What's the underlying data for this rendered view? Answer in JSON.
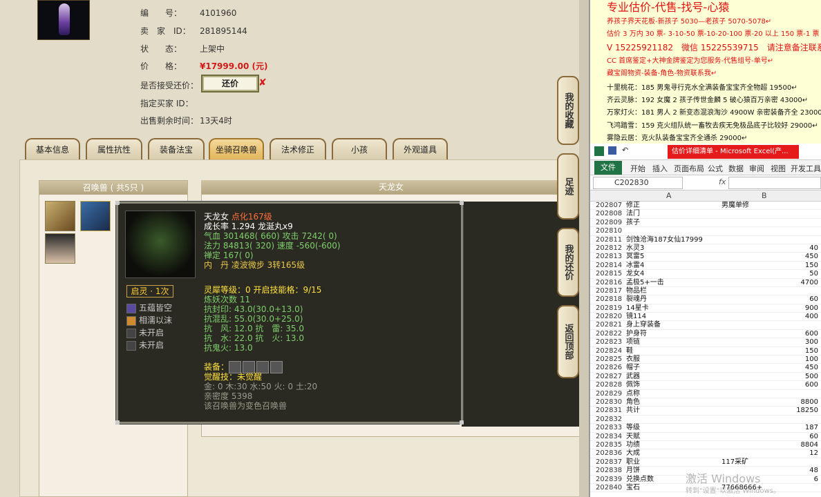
{
  "listing": {
    "serial_label": "编　　号：",
    "serial": "4101960",
    "seller_label": "卖　家　ID：",
    "seller_id": "281895144",
    "status_label": "状　　态：",
    "status": "上架中",
    "price_label": "价　　格：",
    "price": "¥17999.00 (元)",
    "bargain_label": "是否接受还价：",
    "bargain_button": "还价",
    "bargain_x": "✘",
    "buyer_label": "指定买家 ID：",
    "buyer": "",
    "time_label": "出售剩余时间：",
    "time_left": "13天4时"
  },
  "tabs": [
    "基本信息",
    "属性抗性",
    "装备法宝",
    "坐骑召唤兽",
    "法术修正",
    "小孩",
    "外观道具"
  ],
  "active_tab": "坐骑召唤兽",
  "pets": {
    "header": "召唤兽 ( 共5只 )",
    "detail_header": "天龙女"
  },
  "tooltip": {
    "name": "天龙女",
    "upgrade": "点化167级",
    "growth": "成长率 1.294 龙涎丸x9",
    "hp": "气血 301468( 660) 攻击 7242( 0)",
    "mp": "法力 84813( 320) 速度 -560(-600)",
    "zen": "禅定 167( 0)",
    "neidan": "内　丹 凌波微步 3转165级",
    "awaken": "启灵 · 1次",
    "skills": [
      "五蕴皆空",
      "相濡以沫",
      "未开启",
      "未开启"
    ],
    "spirit": "灵犀等级：0 开启技能格：9/15",
    "refine": "炼妖次数 11",
    "r1": "抗封印: 43.0(30.0+13.0)",
    "r2": "抗混乱: 55.0(30.0+25.0)",
    "r3": "抗　风: 12.0 抗　雷: 35.0",
    "r4": "抗　水: 22.0 抗　火: 13.0",
    "r5": "抗鬼火: 13.0",
    "equip_label": "装备：",
    "awake_skill": "觉醒技：未觉醒",
    "elements": "金: 0 木:30 水:50 火: 0 土:20",
    "intimacy": "亲密度 5398",
    "note": "该召唤兽为变色召唤兽"
  },
  "side_buttons": [
    "我的收藏",
    "足迹",
    "我的还价",
    "返回顶部"
  ],
  "ad": {
    "title": "专业估价-代售-找号-心猿",
    "l1": "养孩子界天花板-新孩子 5030—老孩子 5070-5078↵",
    "l2": "估价 3 万内 30 票- 3-10-50 票-10-20-100 票-20 以上 150 票-1 票",
    "l3": "V 15225921182　微信 15225539715　请注意备注联系↵",
    "l4": "CC 首席鉴定+大神金牌鉴定为您服务-代售组号-单号↵",
    "l5": "藏宝阁物资-装备-角色-物资联系我↵",
    "l6": "十里桃花：185 男鬼寻行克水全满装备宝宝齐全物超 19500↵",
    "l7": "齐云灵脉：192 女魔 2 孩子传世金麟 5 破心猿百万亲密 43000↵",
    "l8": "万家灯火：181 男人 2 新变态混浪淘沙 4900W 亲密装备齐全 23000",
    "l9": "飞鸿踏雪：159 克火组队统一畜牧去疾无免极品底子比较好 29000↵",
    "l10": "雾隐云居：克火队装备宝宝齐全通杀 29000↵"
  },
  "excel": {
    "title": "估价详细清单 - Microsoft Excel(产...",
    "file": "文件",
    "ribbon": [
      "开始",
      "插入",
      "页面布局",
      "公式",
      "数据",
      "审阅",
      "视图",
      "开发工具"
    ],
    "namebox": "C202830",
    "fx": "fx",
    "col_a": "A",
    "col_b": "B",
    "rows": [
      {
        "n": "202807",
        "a": "修正",
        "b": "男魔单修",
        "bl": true
      },
      {
        "n": "202808",
        "a": "法门",
        "b": ""
      },
      {
        "n": "202809",
        "a": "孩子",
        "b": ""
      },
      {
        "n": "202810",
        "a": "",
        "b": ""
      },
      {
        "n": "202811",
        "a": "剑蚀沧海187女仙17999",
        "b": ""
      },
      {
        "n": "202812",
        "a": "水灵3",
        "b": "40"
      },
      {
        "n": "202813",
        "a": "冥雷5",
        "b": "450"
      },
      {
        "n": "202814",
        "a": "冰雷4",
        "b": "150"
      },
      {
        "n": "202815",
        "a": "龙女4",
        "b": "50"
      },
      {
        "n": "202816",
        "a": "孟极5+一击",
        "b": "4700"
      },
      {
        "n": "202817",
        "a": "物品栏",
        "b": ""
      },
      {
        "n": "202818",
        "a": "裂魂丹",
        "b": "60"
      },
      {
        "n": "202819",
        "a": "14星卡",
        "b": "900"
      },
      {
        "n": "202820",
        "a": "镜114",
        "b": "400"
      },
      {
        "n": "202821",
        "a": "身上穿装备",
        "b": ""
      },
      {
        "n": "202822",
        "a": "护身符",
        "b": "600"
      },
      {
        "n": "202823",
        "a": "项链",
        "b": "300"
      },
      {
        "n": "202824",
        "a": "鞋",
        "b": "150"
      },
      {
        "n": "202825",
        "a": "衣服",
        "b": "100"
      },
      {
        "n": "202826",
        "a": "帽子",
        "b": "450"
      },
      {
        "n": "202827",
        "a": "武器",
        "b": "500"
      },
      {
        "n": "202828",
        "a": "佩饰",
        "b": "600"
      },
      {
        "n": "202829",
        "a": "点称",
        "b": ""
      },
      {
        "n": "202830",
        "a": "角色",
        "b": "8800"
      },
      {
        "n": "202831",
        "a": "共计",
        "b": "18250"
      },
      {
        "n": "202832",
        "a": "",
        "b": ""
      },
      {
        "n": "202833",
        "a": "等级",
        "b": "187"
      },
      {
        "n": "202834",
        "a": "天赋",
        "b": "60"
      },
      {
        "n": "202835",
        "a": "功绩",
        "b": "8804"
      },
      {
        "n": "202836",
        "a": "大成",
        "b": "12"
      },
      {
        "n": "202837",
        "a": "职业",
        "b": "117采矿",
        "bl": true
      },
      {
        "n": "202838",
        "a": "月饼",
        "b": "48"
      },
      {
        "n": "202839",
        "a": "兑换点数",
        "b": "6"
      },
      {
        "n": "202840",
        "a": "宝石",
        "b": "77668666+",
        "bl": true
      }
    ]
  },
  "watermark": {
    "l1": "激活 Windows",
    "l2": "转到\"设置\"以激活 Windows。"
  }
}
